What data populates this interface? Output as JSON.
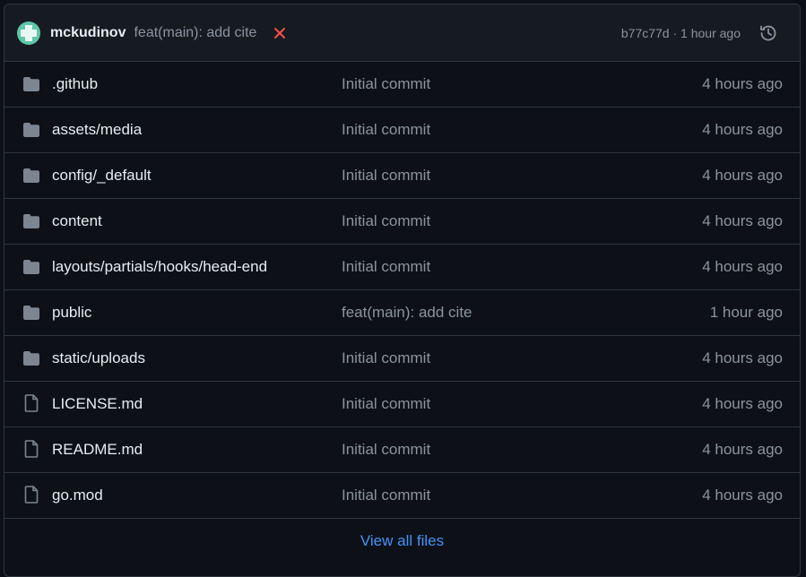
{
  "header": {
    "author": "mckudinov",
    "commit_message": "feat(main): add cite",
    "commit_hash": "b77c77d",
    "separator": " · ",
    "commit_time": "1 hour ago",
    "status_icon": "x-icon",
    "status_color": "#f85149",
    "history_icon": "history-icon"
  },
  "files": [
    {
      "name": ".github",
      "type": "folder",
      "commit": "Initial commit",
      "age": "4 hours ago"
    },
    {
      "name": "assets/media",
      "type": "folder",
      "commit": "Initial commit",
      "age": "4 hours ago"
    },
    {
      "name": "config/_default",
      "type": "folder",
      "commit": "Initial commit",
      "age": "4 hours ago"
    },
    {
      "name": "content",
      "type": "folder",
      "commit": "Initial commit",
      "age": "4 hours ago"
    },
    {
      "name": "layouts/partials/hooks/head-end",
      "type": "folder",
      "commit": "Initial commit",
      "age": "4 hours ago"
    },
    {
      "name": "public",
      "type": "folder",
      "commit": "feat(main): add cite",
      "age": "1 hour ago"
    },
    {
      "name": "static/uploads",
      "type": "folder",
      "commit": "Initial commit",
      "age": "4 hours ago"
    },
    {
      "name": "LICENSE.md",
      "type": "file",
      "commit": "Initial commit",
      "age": "4 hours ago"
    },
    {
      "name": "README.md",
      "type": "file",
      "commit": "Initial commit",
      "age": "4 hours ago"
    },
    {
      "name": "go.mod",
      "type": "file",
      "commit": "Initial commit",
      "age": "4 hours ago"
    }
  ],
  "footer": {
    "view_all_label": "View all files"
  },
  "colors": {
    "background": "#0d1117",
    "header_bg": "#161b22",
    "border": "#30363d",
    "text": "#e6edf3",
    "muted": "#8b949e",
    "link": "#4493f8",
    "icon": "#7d8590"
  }
}
